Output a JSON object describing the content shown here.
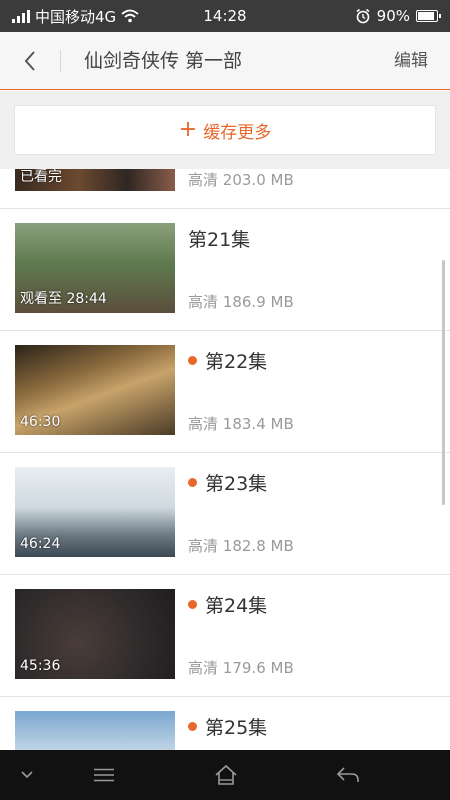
{
  "status_bar": {
    "carrier": "中国移动4G",
    "time": "14:28",
    "battery": "90%",
    "battery_level": 0.9
  },
  "header": {
    "title": "仙剑奇侠传 第一部",
    "edit_label": "编辑"
  },
  "cache_more": {
    "icon": "plus-icon",
    "label": "缓存更多"
  },
  "episodes": [
    {
      "title": "",
      "badge": "已看完",
      "quality": "高清",
      "size": "203.0 MB",
      "is_new": false
    },
    {
      "title": "第21集",
      "badge": "观看至 28:44",
      "quality": "高清",
      "size": "186.9 MB",
      "is_new": false
    },
    {
      "title": "第22集",
      "badge": "46:30",
      "quality": "高清",
      "size": "183.4 MB",
      "is_new": true
    },
    {
      "title": "第23集",
      "badge": "46:24",
      "quality": "高清",
      "size": "182.8 MB",
      "is_new": true
    },
    {
      "title": "第24集",
      "badge": "45:36",
      "quality": "高清",
      "size": "179.6 MB",
      "is_new": true
    },
    {
      "title": "第25集",
      "badge": "",
      "quality": "",
      "size": "",
      "is_new": true
    }
  ],
  "colors": {
    "accent": "#e8672a",
    "status_bar": "#3b3b3b",
    "nav_bar": "#111111"
  },
  "nav_bar": {
    "icons": [
      "chevron-down-icon",
      "menu-icon",
      "home-icon",
      "back-arrow-icon"
    ]
  }
}
